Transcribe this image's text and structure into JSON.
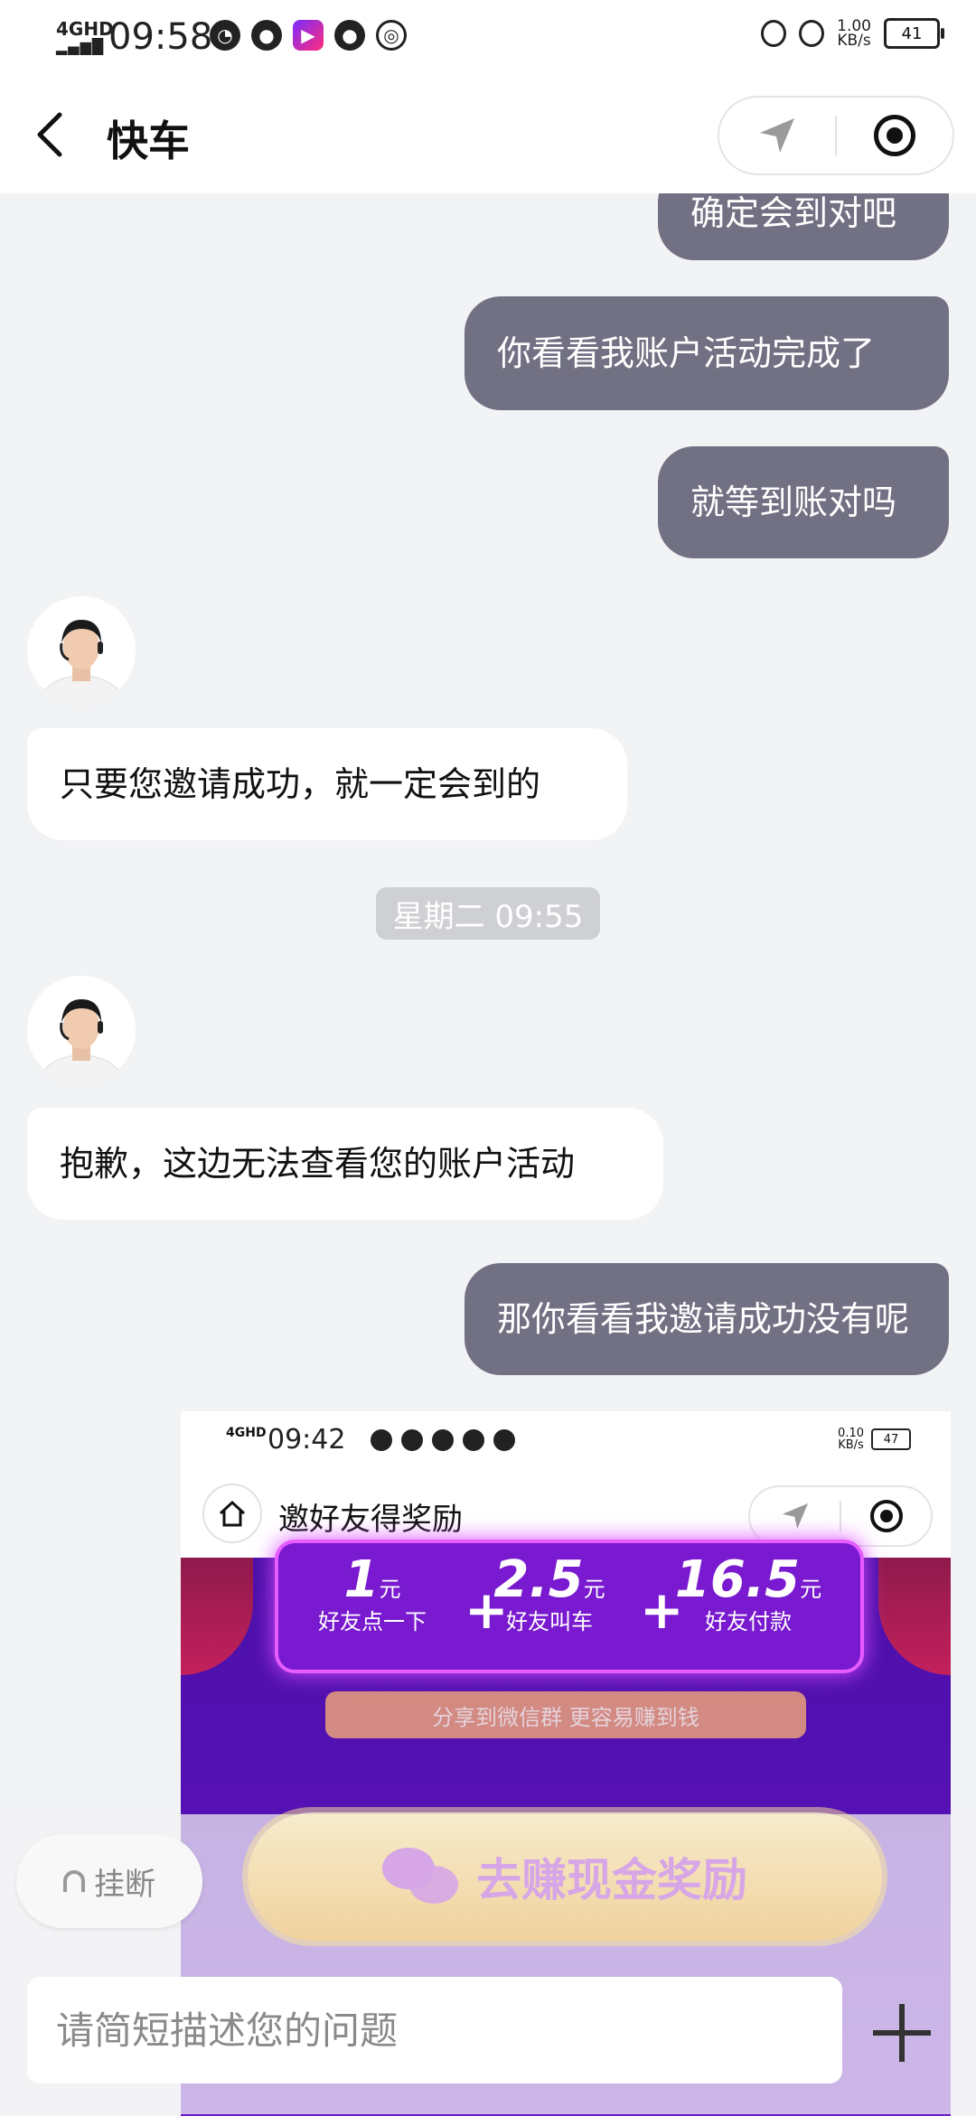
{
  "status_bar": {
    "network": "4GHD",
    "time": "09:58",
    "net_rate_value": "1.00",
    "net_rate_unit": "KB/s",
    "battery": "41"
  },
  "header": {
    "title": "快车"
  },
  "messages": [
    {
      "side": "user",
      "text": "确定会到对吧"
    },
    {
      "side": "user",
      "text": "你看看我账户活动完成了"
    },
    {
      "side": "user",
      "text": "就等到账对吗"
    },
    {
      "side": "agent",
      "text": "只要您邀请成功，就一定会到的"
    },
    {
      "side": "agent",
      "text": "抱歉，这边无法查看您的账户活动"
    },
    {
      "side": "user",
      "text": "那你看看我邀请成功没有呢"
    }
  ],
  "timestamp": "星期二 09:55",
  "shared_screenshot": {
    "time": "09:42",
    "network": "4GHD",
    "net_rate_value": "0.10",
    "net_rate_unit": "KB/s",
    "battery": "47",
    "page_title": "邀好友得奖励",
    "rewards": [
      {
        "amount": "1",
        "unit": "元",
        "caption": "好友点一下"
      },
      {
        "amount": "2.5",
        "unit": "元",
        "caption": "好友叫车"
      },
      {
        "amount": "16.5",
        "unit": "元",
        "caption": "好友付款"
      }
    ],
    "plus_sign": "+",
    "share_tip": "分享到微信群 更容易赚到钱"
  },
  "overlay": {
    "hangup_label": "挂断",
    "earn_button_label": "去赚现金奖励"
  },
  "input": {
    "placeholder": "请简短描述您的问题"
  }
}
